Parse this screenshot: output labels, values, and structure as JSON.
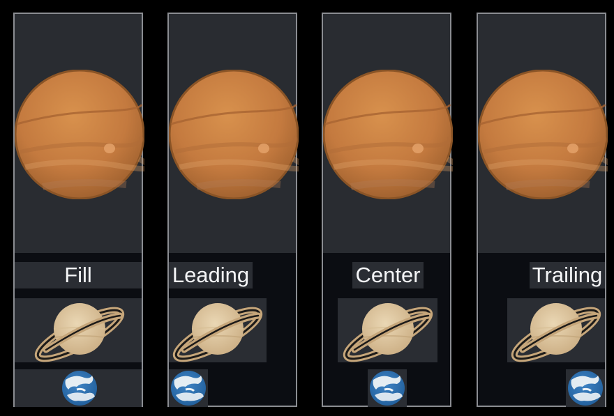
{
  "panels": [
    {
      "id": "fill",
      "label": "Fill"
    },
    {
      "id": "leading",
      "label": "Leading"
    },
    {
      "id": "center",
      "label": "Center"
    },
    {
      "id": "trailing",
      "label": "Trailing"
    }
  ],
  "images": {
    "top": "jupiter-icon",
    "middle": "saturn-icon",
    "bottom": "earth-icon"
  },
  "colors": {
    "background": "#000000",
    "panel_top": "#292c31",
    "panel_bottom": "#0b0d12",
    "strip": "#2a2d33",
    "border": "#8b8d92",
    "text": "#f4f5f7"
  }
}
